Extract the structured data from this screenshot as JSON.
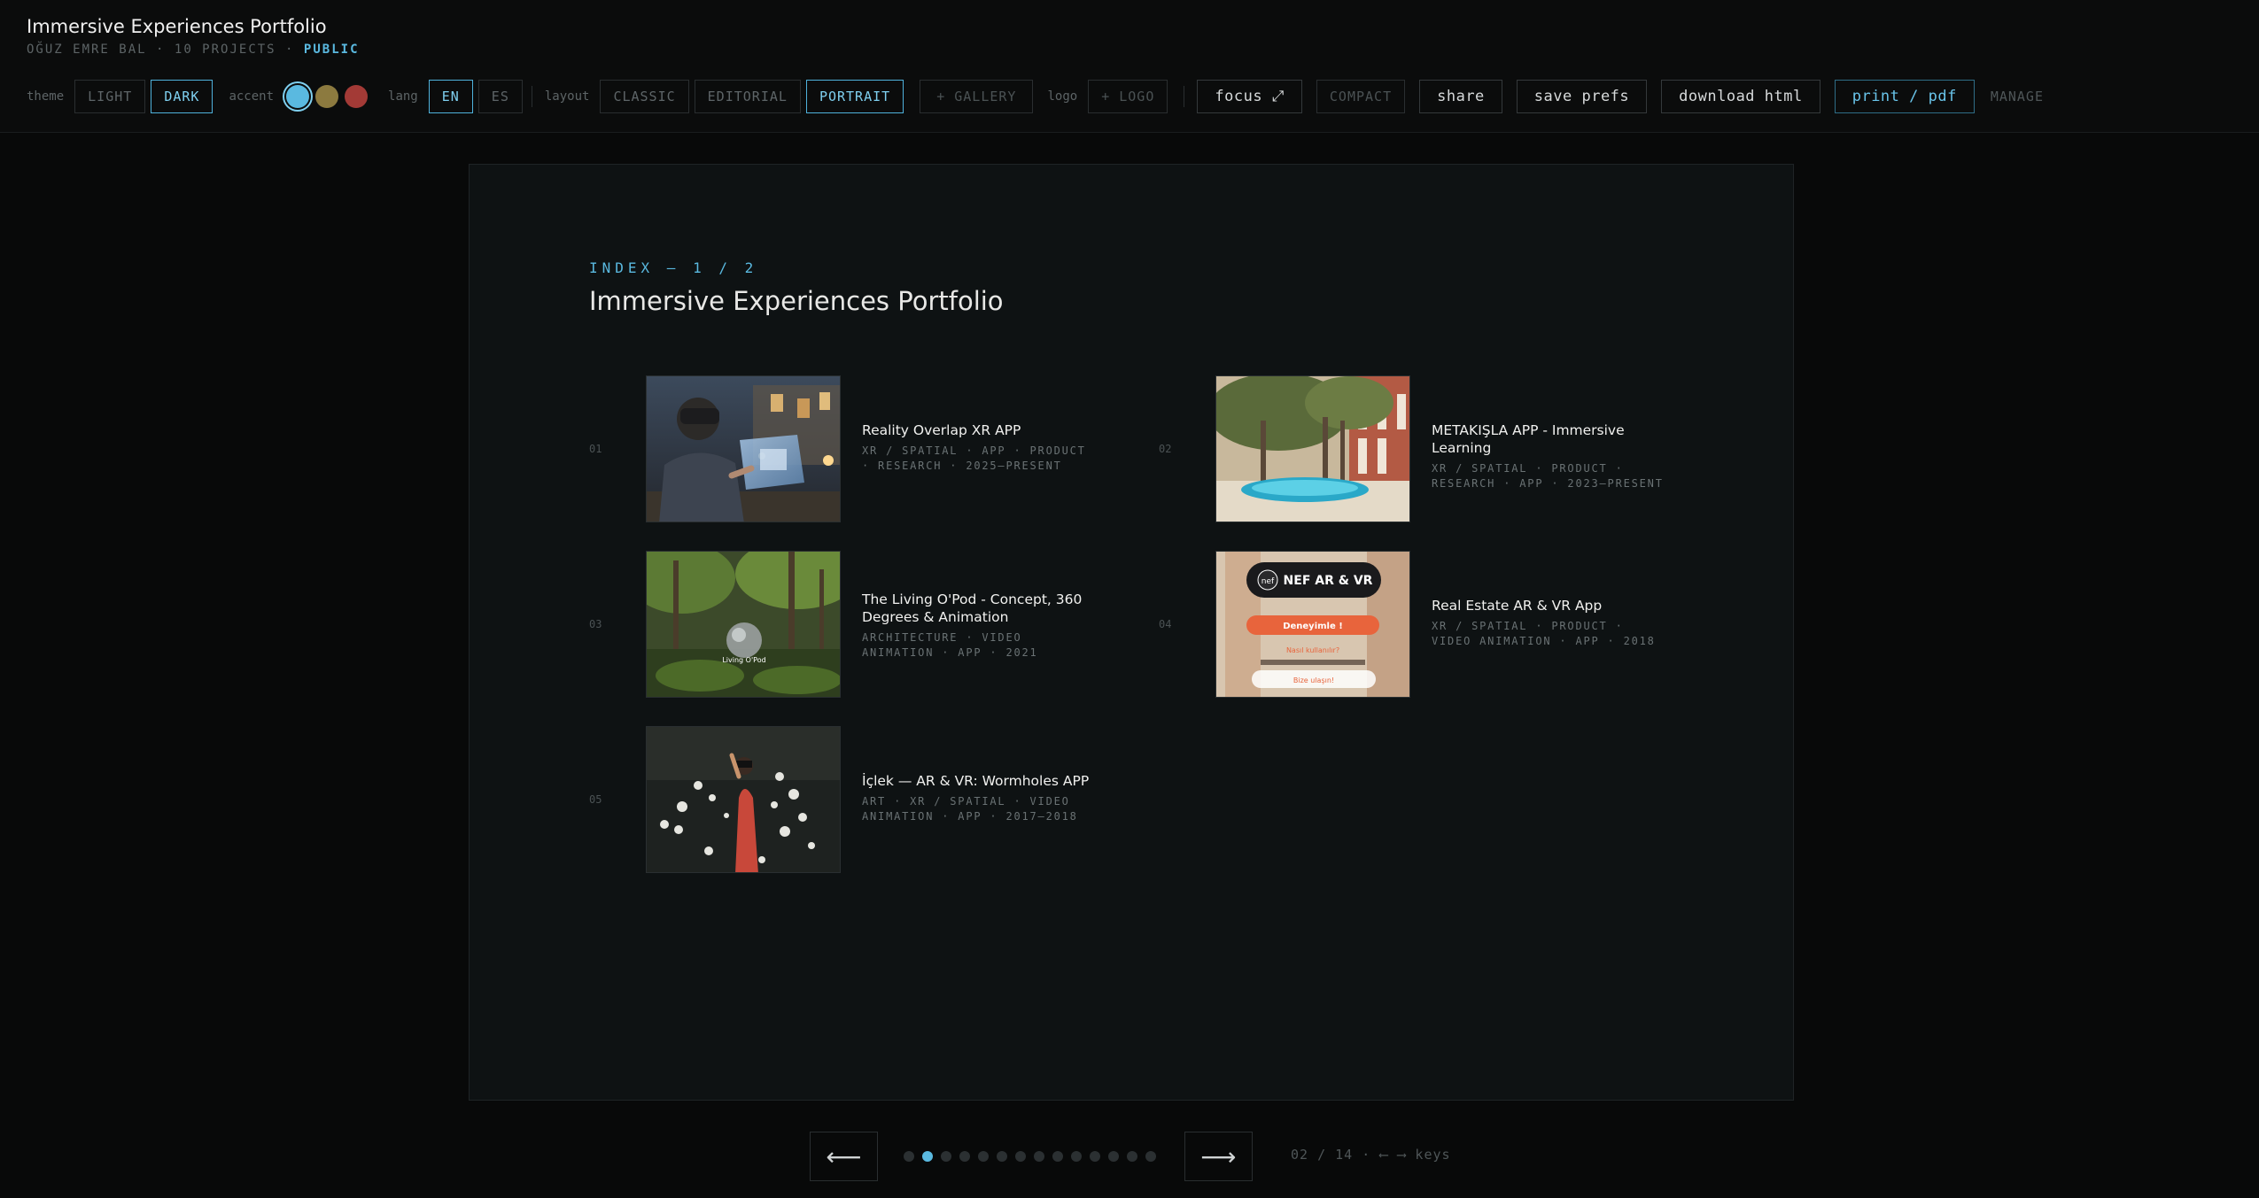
{
  "header": {
    "title": "Immersive Experiences Portfolio",
    "author": "OĞUZ EMRE BAL",
    "projects": "10 PROJECTS",
    "sep": "·",
    "visibility": "PUBLIC"
  },
  "toolbar": {
    "theme_label": "theme",
    "theme_options": [
      "LIGHT",
      "DARK"
    ],
    "theme_selected": "DARK",
    "accent_label": "accent",
    "accent_colors": [
      "#5ab9e0",
      "#8c7a3f",
      "#a33a36"
    ],
    "accent_selected": "#5ab9e0",
    "lang_label": "lang",
    "lang_options": [
      "EN",
      "ES"
    ],
    "lang_selected": "EN",
    "layout_label": "layout",
    "layout_options": [
      "CLASSIC",
      "EDITORIAL",
      "PORTRAIT"
    ],
    "layout_selected": "PORTRAIT",
    "gallery_button": "+ GALLERY",
    "logo_label": "logo",
    "logo_button": "+ LOGO",
    "focus_button": "focus ⤢",
    "compact_button": "COMPACT",
    "share_button": "share",
    "save_prefs_button": "save prefs",
    "download_button": "download html",
    "print_button": "print / pdf",
    "manage_link": "MANAGE"
  },
  "slide": {
    "eyebrow": "INDEX — 1 / 2",
    "title": "Immersive Experiences Portfolio",
    "projects": [
      {
        "num": "01",
        "title": "Reality Overlap XR APP",
        "meta": "XR / SPATIAL · APP · PRODUCT · RESEARCH · 2025–PRESENT"
      },
      {
        "num": "02",
        "title": "METAKIŞLA APP - Immersive Learning",
        "meta": "XR / SPATIAL · PRODUCT · RESEARCH · APP · 2023–PRESENT"
      },
      {
        "num": "03",
        "title": "The Living O'Pod - Concept, 360 Degrees & Animation",
        "meta": "ARCHITECTURE · VIDEO ANIMATION · APP · 2021"
      },
      {
        "num": "04",
        "title": "Real Estate AR & VR App",
        "meta": "XR / SPATIAL · PRODUCT · VIDEO ANIMATION · APP · 2018"
      },
      {
        "num": "05",
        "title": "İçlek — AR & VR: Wormholes APP",
        "meta": "ART · XR / SPATIAL · VIDEO ANIMATION · APP · 2017–2018"
      }
    ],
    "thumb_texts": {
      "opod": "Living O'Pod",
      "nef_brand": "nef",
      "nef_title": "NEF AR & VR",
      "nef_cta": "Deneyimle !",
      "nef_how": "Nasıl kullanılır?",
      "nef_contact": "Bize ulaşın!"
    }
  },
  "nav": {
    "prev": "⟵",
    "next": "⟶",
    "total_pages": 14,
    "current_page": 2,
    "page_info": "02 / 14 · ⟵ ⟶ keys"
  }
}
